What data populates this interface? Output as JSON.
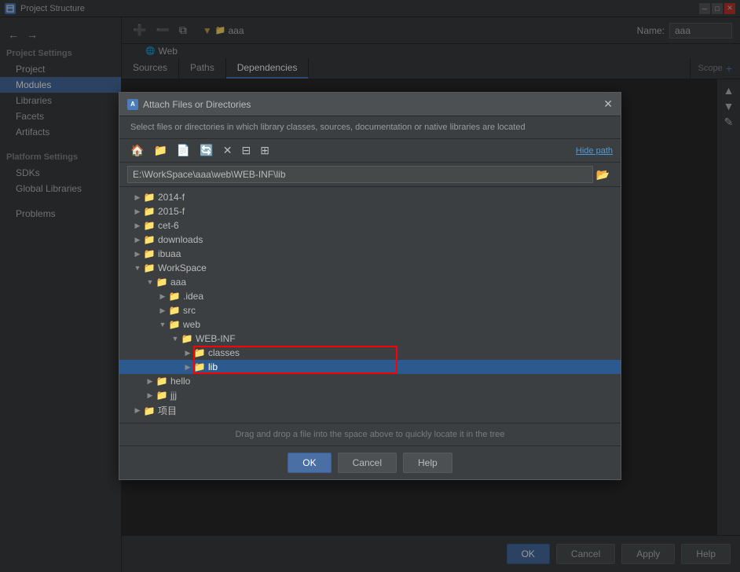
{
  "window": {
    "title": "Project Structure",
    "icon_label": "P"
  },
  "sidebar": {
    "project_settings_label": "Project Settings",
    "items": [
      {
        "id": "project",
        "label": "Project"
      },
      {
        "id": "modules",
        "label": "Modules",
        "active": true
      },
      {
        "id": "libraries",
        "label": "Libraries"
      },
      {
        "id": "facets",
        "label": "Facets"
      },
      {
        "id": "artifacts",
        "label": "Artifacts"
      }
    ],
    "platform_settings_label": "Platform Settings",
    "platform_items": [
      {
        "id": "sdks",
        "label": "SDKs"
      },
      {
        "id": "global-libraries",
        "label": "Global Libraries"
      }
    ],
    "problems_label": "Problems"
  },
  "module_header": {
    "name_label": "Name:",
    "name_value": "aaa"
  },
  "tabs": [
    {
      "id": "sources",
      "label": "Sources"
    },
    {
      "id": "paths",
      "label": "Paths"
    },
    {
      "id": "dependencies",
      "label": "Dependencies"
    }
  ],
  "module_tree": {
    "root_label": "aaa",
    "web_label": "Web"
  },
  "scope_panel": {
    "label": "Scope",
    "add_icon": "+"
  },
  "bottom_buttons": {
    "ok": "OK",
    "cancel": "Cancel",
    "apply": "Apply",
    "help": "Help"
  },
  "dialog": {
    "title": "Attach Files or Directories",
    "icon_label": "A",
    "description": "Select files or directories in which library classes, sources, documentation or native libraries are located",
    "hide_path_label": "Hide path",
    "path_value": "E:\\WorkSpace\\aaa\\web\\WEB-INF\\lib",
    "tree_items": [
      {
        "id": "2014-f",
        "label": "2014-f",
        "indent": 1,
        "expanded": false
      },
      {
        "id": "2015-f",
        "label": "2015-f",
        "indent": 1,
        "expanded": false
      },
      {
        "id": "cet-6",
        "label": "cet-6",
        "indent": 1,
        "expanded": false
      },
      {
        "id": "downloads",
        "label": "downloads",
        "indent": 1,
        "expanded": false
      },
      {
        "id": "ibuaa",
        "label": "ibuaa",
        "indent": 1,
        "expanded": false
      },
      {
        "id": "workspace",
        "label": "WorkSpace",
        "indent": 1,
        "expanded": true
      },
      {
        "id": "aaa",
        "label": "aaa",
        "indent": 2,
        "expanded": true
      },
      {
        "id": "idea",
        "label": ".idea",
        "indent": 3,
        "expanded": false
      },
      {
        "id": "src",
        "label": "src",
        "indent": 3,
        "expanded": false
      },
      {
        "id": "web",
        "label": "web",
        "indent": 3,
        "expanded": true
      },
      {
        "id": "webinf",
        "label": "WEB-INF",
        "indent": 4,
        "expanded": true
      },
      {
        "id": "classes",
        "label": "classes",
        "indent": 5,
        "expanded": false,
        "highlighted": true
      },
      {
        "id": "lib",
        "label": "lib",
        "indent": 5,
        "expanded": false,
        "selected": true,
        "highlighted": true
      },
      {
        "id": "hello",
        "label": "hello",
        "indent": 2,
        "expanded": false
      },
      {
        "id": "jjj",
        "label": "jjj",
        "indent": 2,
        "expanded": false
      },
      {
        "id": "xiang-mu",
        "label": "项目",
        "indent": 1,
        "expanded": false
      }
    ],
    "drop_hint": "Drag and drop a file into the space above to quickly locate it in the tree",
    "buttons": {
      "ok": "OK",
      "cancel": "Cancel",
      "help": "Help"
    }
  }
}
